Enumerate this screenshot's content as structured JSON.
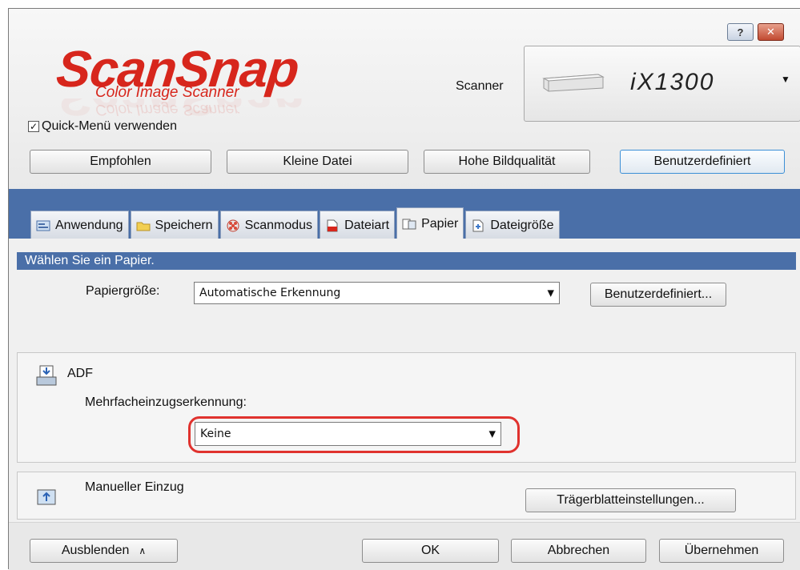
{
  "window": {
    "help_label": "?",
    "close_label": "✕"
  },
  "logo": {
    "title": "ScanSnap",
    "subtitle": "Color Image Scanner",
    "brand_color": "#d7261c"
  },
  "scanner": {
    "label": "Scanner",
    "model": "iX1300"
  },
  "quick_menu": {
    "label": "Quick-Menü verwenden",
    "checked": true
  },
  "profiles": [
    {
      "label": "Empfohlen"
    },
    {
      "label": "Kleine Datei"
    },
    {
      "label": "Hohe Bildqualität"
    },
    {
      "label": "Benutzerdefiniert",
      "selected": true
    }
  ],
  "tabs": [
    {
      "label": "Anwendung",
      "icon": "application-icon"
    },
    {
      "label": "Speichern",
      "icon": "folder-icon"
    },
    {
      "label": "Scanmodus",
      "icon": "scan-mode-icon"
    },
    {
      "label": "Dateiart",
      "icon": "file-type-icon"
    },
    {
      "label": "Papier",
      "icon": "paper-icon",
      "active": true
    },
    {
      "label": "Dateigröße",
      "icon": "file-size-icon"
    }
  ],
  "paper": {
    "section_title": "Wählen Sie ein Papier.",
    "size_label": "Papiergröße:",
    "size_value": "Automatische Erkennung",
    "custom_button": "Benutzerdefiniert..."
  },
  "adf": {
    "title": "ADF",
    "multifeed_label": "Mehrfacheinzugserkennung:",
    "multifeed_value": "Keine"
  },
  "manual": {
    "title": "Manueller Einzug",
    "carrier_button": "Trägerblatteinstellungen..."
  },
  "footer": {
    "hide_label": "Ausblenden",
    "ok_label": "OK",
    "cancel_label": "Abbrechen",
    "apply_label": "Übernehmen"
  },
  "colors": {
    "accent_blue": "#4a6fa8",
    "highlight_red": "#e0322e"
  }
}
